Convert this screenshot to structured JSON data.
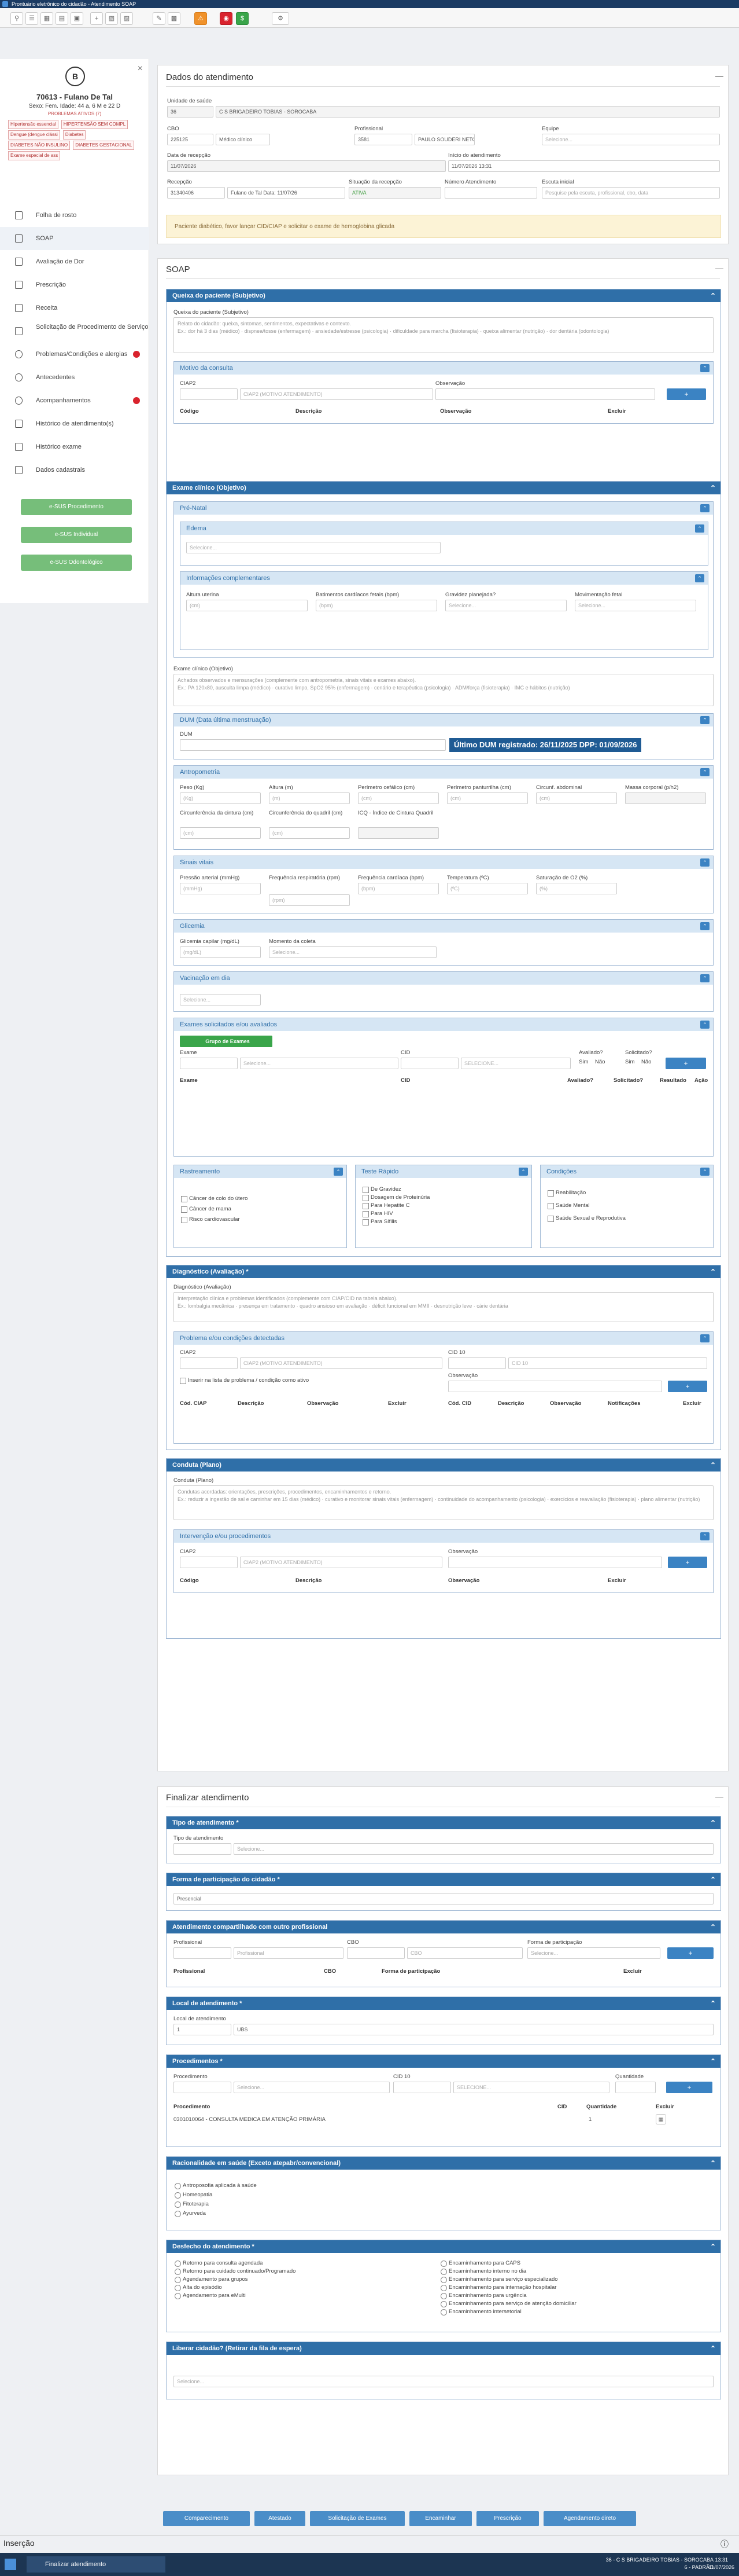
{
  "window": {
    "title": "Prontuário eletrônico do cidadão - Atendimento SOAP"
  },
  "patient": {
    "initial": "B",
    "name": "70613 - Fulano De Tal",
    "info": "Sexo: Fem.  Idade: 44 a, 6 M e 22 D",
    "info2": "PROBLEMAS ATIVOS (7)"
  },
  "alerts": [
    "Hipertensão essencial",
    "HIPERTENSÃO SEM COMPL",
    "Dengue (dengue clássi",
    "Diabetes",
    "DIABETES NÃO INSULINO",
    "DIABETES GESTACIONAL",
    "Exame especial de ass"
  ],
  "sidebar": [
    {
      "label": "Folha de rosto"
    },
    {
      "label": "SOAP"
    },
    {
      "label": "Avaliação de Dor"
    },
    {
      "label": "Prescrição"
    },
    {
      "label": "Receita"
    },
    {
      "label": "Solicitação de Procedimento de Serviço"
    },
    {
      "label": "Problemas/Condições e alergias"
    },
    {
      "label": "Antecedentes"
    },
    {
      "label": "Acompanhamentos"
    },
    {
      "label": "Histórico de atendimento(s)"
    },
    {
      "label": "Histórico exame"
    },
    {
      "label": "Dados cadastrais"
    }
  ],
  "green_buttons": [
    "e-SUS Procedimento",
    "e-SUS Individual",
    "e-SUS Odontológico"
  ],
  "dados": {
    "title": "Dados do atendimento",
    "unidade_label": "Unidade de saúde",
    "unidade_code": "36",
    "unidade_name": "C S BRIGADEIRO TOBIAS - SOROCABA",
    "cbo_label": "CBO",
    "cbo_code": "225125",
    "cbo_name": "Médico clínico",
    "prof_label": "Profissional",
    "prof_code": "3581",
    "prof_name": "PAULO SOUDERI NETO",
    "equipe_label": "Equipe",
    "equipe_value": "Selecione...",
    "data_rec_label": "Data de recepção",
    "data_rec_value": "11/07/2026",
    "inicio_label": "Início do atendimento",
    "inicio_value": "11/07/2026 13:31",
    "recep_label": "Recepção",
    "recep_code": "31340406",
    "recep_name": "Fulano de Tal Data: 11/07/26",
    "sit_label": "Situação da recepção",
    "sit_value": "ATIVA",
    "num_label": "Número Atendimento",
    "num_value": "",
    "escuta_label": "Escuta inicial",
    "escuta_value": "Pesquise pela escuta, profissional, cbo, data",
    "info_msg": "Paciente diabético, favor lançar CID/CIAP e solicitar o exame de hemoglobina glicada"
  },
  "soap": {
    "title": "SOAP",
    "queixa_h": "Queixa do paciente (Subjetivo)",
    "queixa_lbl": "Queixa do paciente (Subjetivo)",
    "queixa_ph": "Relato do cidadão: queixa, sintomas, sentimentos, expectativas e contexto.\nEx.: dor há 3 dias (médico) · dispnea/tosse (enfermagem) · ansiedade/estresse (psicologia) · dificuldade para marcha (fisioterapia) · queixa alimentar (nutrição) · dor dentária (odontologia)",
    "motivo_h": "Motivo da consulta",
    "ciap_lbl": "CIAP2",
    "obs_lbl": "Observação",
    "ciap_ph": "CIAP2 (MOTIVO ATENDIMENTO)",
    "cols": [
      "Código",
      "Descrição",
      "Observação",
      "Excluir"
    ],
    "exame_h": "Exame clínico (Objetivo)",
    "prenatal_h": "Pré-Natal",
    "edema_h": "Edema",
    "sel": "Selecione...",
    "compl_h": "Informações complementares",
    "altura_uter": "Altura uterina",
    "bat_card": "Batimentos cardíacos fetais (bpm)",
    "grav_plan": "Gravidez planejada?",
    "mov_fetal": "Movimentação fetal",
    "cm_ph": "(cm)",
    "bpm_ph": "(bpm)",
    "exame_lbl": "Exame clínico (Objetivo)",
    "exame_ph": "Achados observados e mensurações (complemente com antropometria, sinais vitais e exames abaixo).\nEx.: PA 120x80, ausculta limpa (médico) · curativo limpo, SpO2 95% (enfermagem) · cenário e terapêutica (psicologia) · ADM/força (fisioterapia) · IMC e hábitos (nutrição)",
    "dum_h": "DUM (Data última menstruação)",
    "dum_lbl": "DUM",
    "dum_box": "Último DUM registrado: 26/11/2025  DPP: 01/09/2026",
    "antro_h": "Antropometria",
    "peso": "Peso (Kg)",
    "altura": "Altura (m)",
    "perim_cef": "Perímetro cefálico (cm)",
    "perim_pan": "Perímetro panturrilha (cm)",
    "circ_abd": "Circunf. abdominal",
    "massa": "Massa corporal (p/h2)",
    "kg": "(Kg)",
    "m": "(m)",
    "cm": "(cm)",
    "circ_cint": "Circunferência da cintura (cm)",
    "circ_quad": "Circunferência do quadril (cm)",
    "icq": "ICQ - Índice de Cintura Quadril",
    "sinais_h": "Sinais vitais",
    "pa": "Pressão arterial (mmHg)",
    "fr": "Frequência respiratória (rpm)",
    "fc": "Frequência cardíaca (bpm)",
    "temp": "Temperatura (ºC)",
    "sat": "Saturação de O2 (%)",
    "mmhg": "(mmHg)",
    "rpm": "(rpm)",
    "bpm": "(bpm)",
    "c": "(ºC)",
    "pct": "(%)",
    "glic_h": "Glicemia",
    "glic_lbl": "Glicemia capilar (mg/dL)",
    "momento": "Momento da coleta",
    "mgdl": "(mg/dL)",
    "vac_h": "Vacinação em dia",
    "exames_h": "Exames solicitados e/ou avaliados",
    "grupo_btn": "Grupo de Exames",
    "exame_f": "Exame",
    "cid_f": "CID",
    "avaliado": "Avaliado?",
    "solicitado": "Solicitado?",
    "sim": "Sim",
    "nao": "Não",
    "cid_ph": "SELECIONE...",
    "ex_cols": [
      "Exame",
      "CID",
      "Avaliado?",
      "Solicitado?",
      "Resultado",
      "Ação"
    ],
    "rast_h": "Rastreamento",
    "rast": [
      "Câncer de colo do útero",
      "Câncer de mama",
      "Risco cardiovascular"
    ],
    "teste_h": "Teste Rápido",
    "teste": [
      "De Gravidez",
      "Dosagem de Proteinúria",
      "Para Hepatite C",
      "Para HIV",
      "Para Sífilis"
    ],
    "cond_h": "Condições",
    "cond": [
      "Reabilitação",
      "Saúde Mental",
      "Saúde Sexual e Reprodutiva"
    ],
    "diag_h": "Diagnóstico (Avaliação) *",
    "diag_lbl": "Diagnóstico (Avaliação)",
    "diag_ph": "Interpretação clínica e problemas identificados (complemente com CIAP/CID na tabela abaixo).\nEx.: lombalgia mecânica · presença em tratamento · quadro ansioso em avaliação · déficit funcional em MMII · desnutrição leve · cárie dentária",
    "prob_h": "Problema e/ou condições detectadas",
    "cid10": "CID 10",
    "cid10_ph": "CID 10",
    "inserir_lista": "Inserir na lista de problema / condição como ativo",
    "prob_cols": [
      "Cód. CIAP",
      "Descrição",
      "Observação",
      "Excluir",
      "Cód. CID",
      "Descrição",
      "Observação",
      "Notificações",
      "Excluir"
    ],
    "conduta_h": "Conduta (Plano)",
    "conduta_lbl": "Conduta (Plano)",
    "conduta_ph": "Condutas acordadas: orientações, prescrições, procedimentos, encaminhamentos e retorno.\nEx.: reduzir a ingestão de sal e caminhar em 15 dias (médico) · curativo e monitorar sinais vitais (enfermagem) · continuidade do acompanhamento (psicologia) · exercícios e reavaliação (fisioterapia) · plano alimentar (nutrição)",
    "interv_h": "Intervenção e/ou procedimentos"
  },
  "finalizar": {
    "title": "Finalizar atendimento",
    "tipo_h": "Tipo de atendimento *",
    "tipo_lbl": "Tipo de atendimento",
    "forma_h": "Forma de participação do cidadão *",
    "forma_val": "Presencial",
    "comp_h": "Atendimento compartilhado com outro profissional",
    "prof": "Profissional",
    "cbo": "CBO",
    "forma_part": "Forma de participação",
    "excluir": "Excluir",
    "local_h": "Local de atendimento *",
    "local_lbl": "Local de atendimento",
    "local_val": "1",
    "local_name": "UBS",
    "proc_h": "Procedimentos *",
    "proc_lbl": "Procedimento",
    "quant": "Quantidade",
    "proc_cols": [
      "Procedimento",
      "CID",
      "Quantidade",
      "Excluir"
    ],
    "proc_row": "0301010064 - CONSULTA MEDICA EM ATENÇÃO PRIMÁRIA",
    "proc_qty": "1",
    "racio_h": "Racionalidade em saúde (Exceto atepabr/convencional)",
    "racio": [
      "Antroposofia aplicada à saúde",
      "Homeopatia",
      "Fitoterapia",
      "Ayurveda"
    ],
    "desfecho_h": "Desfecho do atendimento *",
    "desfecho_l": [
      "Retorno para consulta agendada",
      "Retorno para cuidado continuado/Programado",
      "Agendamento para grupos",
      "Alta do episódio",
      "Agendamento para eMulti"
    ],
    "desfecho_r": [
      "Encaminhamento para CAPS",
      "Encaminhamento interno no dia",
      "Encaminhamento para serviço especializado",
      "Encaminhamento para internação hospitalar",
      "Encaminhamento para urgência",
      "Encaminhamento para serviço de atenção domiciliar",
      "Encaminhamento intersetorial"
    ],
    "liberar_h": "Liberar cidadão? (Retirar da fila de espera)"
  },
  "bottom_buttons": [
    "Comparecimento",
    "Atestado",
    "Solicitação de Exames",
    "Encaminhar",
    "Prescrição",
    "Agendamento direto"
  ],
  "footer": {
    "label": "Inserção"
  },
  "taskbar": {
    "item": "Finalizar atendimento",
    "unit": "36 - C S BRIGADEIRO TOBIAS - SOROCABA",
    "user": "6 - PADRÃO",
    "time": "13:31",
    "date": "11/07/2026"
  }
}
